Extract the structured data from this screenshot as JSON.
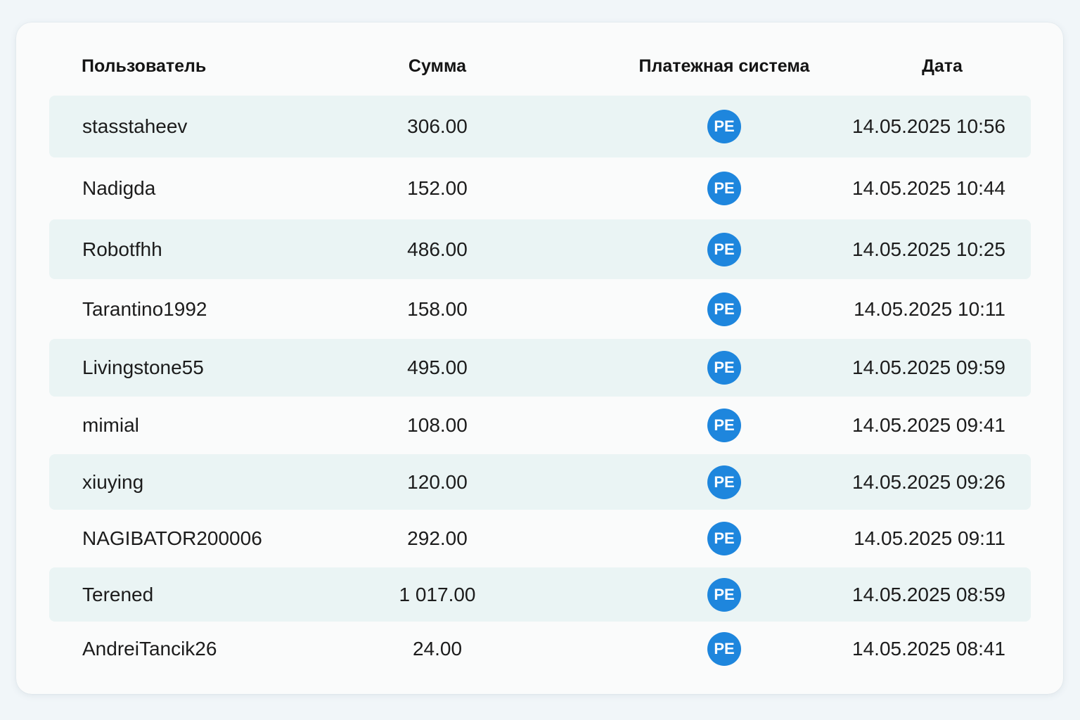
{
  "table": {
    "columns": {
      "user": "Пользователь",
      "amount": "Сумма",
      "system": "Платежная система",
      "date": "Дата"
    },
    "rows": [
      {
        "user": "stasstaheev",
        "amount": "306.00",
        "system": "PE",
        "date": "14.05.2025 10:56"
      },
      {
        "user": "Nadigda",
        "amount": "152.00",
        "system": "PE",
        "date": "14.05.2025 10:44"
      },
      {
        "user": "Robotfhh",
        "amount": "486.00",
        "system": "PE",
        "date": "14.05.2025 10:25"
      },
      {
        "user": "Tarantino1992",
        "amount": "158.00",
        "system": "PE",
        "date": "14.05.2025 10:11"
      },
      {
        "user": "Livingstone55",
        "amount": "495.00",
        "system": "PE",
        "date": "14.05.2025 09:59"
      },
      {
        "user": "mimial",
        "amount": "108.00",
        "system": "PE",
        "date": "14.05.2025 09:41"
      },
      {
        "user": "xiuying",
        "amount": "120.00",
        "system": "PE",
        "date": "14.05.2025 09:26"
      },
      {
        "user": "NAGIBATOR200006",
        "amount": "292.00",
        "system": "PE",
        "date": "14.05.2025 09:11"
      },
      {
        "user": "Terened",
        "amount": "1 017.00",
        "system": "PE",
        "date": "14.05.2025 08:59"
      },
      {
        "user": "AndreiTancik26",
        "amount": "24.00",
        "system": "PE",
        "date": "14.05.2025 08:41"
      }
    ]
  },
  "colors": {
    "page_background": "#f1f6f9",
    "card_background": "#fafbfb",
    "shaded_row": "#eaf4f4",
    "payment_badge": "#1e86dd"
  },
  "icons": {
    "payment_system": "payeer-badge"
  }
}
